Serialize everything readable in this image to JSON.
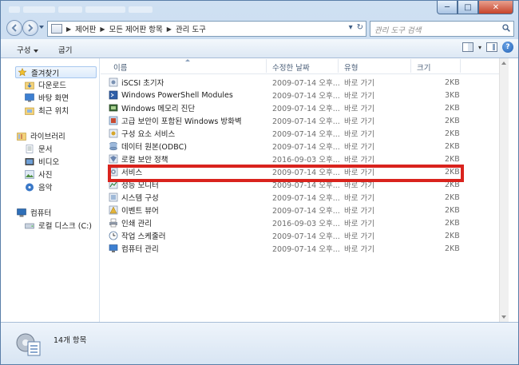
{
  "window": {
    "controls": {
      "minimize": "─",
      "maximize": "□",
      "close": "✕"
    }
  },
  "navigation": {
    "breadcrumbs": [
      "제어판",
      "모든 제어판 항목",
      "관리 도구"
    ],
    "refresh_glyph": "↻",
    "search_placeholder": "관리 도구 검색"
  },
  "toolbar": {
    "organize_label": "구성",
    "burn_label": "굽기",
    "help_glyph": "?"
  },
  "sidebar": {
    "favorites": {
      "label": "즐겨찾기",
      "items": [
        {
          "label": "다운로드"
        },
        {
          "label": "바탕 화면"
        },
        {
          "label": "최근 위치"
        }
      ]
    },
    "libraries": {
      "label": "라이브러리",
      "items": [
        {
          "label": "문서"
        },
        {
          "label": "비디오"
        },
        {
          "label": "사진"
        },
        {
          "label": "음악"
        }
      ]
    },
    "computer": {
      "label": "컴퓨터",
      "items": [
        {
          "label": "로컬 디스크 (C:)"
        }
      ]
    }
  },
  "file_list": {
    "columns": {
      "name": "이름",
      "date": "수정한 날짜",
      "type": "유형",
      "size": "크기"
    },
    "rows": [
      {
        "name": "iSCSI 초기자",
        "date": "2009-07-14 오후...",
        "type": "바로 가기",
        "size": "2KB"
      },
      {
        "name": "Windows PowerShell Modules",
        "date": "2009-07-14 오후...",
        "type": "바로 가기",
        "size": "3KB"
      },
      {
        "name": "Windows 메모리 진단",
        "date": "2009-07-14 오후...",
        "type": "바로 가기",
        "size": "2KB"
      },
      {
        "name": "고급 보안이 포함된 Windows 방화벽",
        "date": "2009-07-14 오후...",
        "type": "바로 가기",
        "size": "2KB"
      },
      {
        "name": "구성 요소 서비스",
        "date": "2009-07-14 오후...",
        "type": "바로 가기",
        "size": "2KB"
      },
      {
        "name": "데이터 원본(ODBC)",
        "date": "2009-07-14 오후...",
        "type": "바로 가기",
        "size": "2KB"
      },
      {
        "name": "로컬 보안 정책",
        "date": "2016-09-03 오후...",
        "type": "바로 가기",
        "size": "2KB"
      },
      {
        "name": "서비스",
        "date": "2009-07-14 오후...",
        "type": "바로 가기",
        "size": "2KB"
      },
      {
        "name": "성능 모니터",
        "date": "2009-07-14 오후...",
        "type": "바로 가기",
        "size": "2KB"
      },
      {
        "name": "시스템 구성",
        "date": "2009-07-14 오후...",
        "type": "바로 가기",
        "size": "2KB"
      },
      {
        "name": "이벤트 뷰어",
        "date": "2009-07-14 오후...",
        "type": "바로 가기",
        "size": "2KB"
      },
      {
        "name": "인쇄 관리",
        "date": "2016-09-03 오후...",
        "type": "바로 가기",
        "size": "2KB"
      },
      {
        "name": "작업 스케줄러",
        "date": "2009-07-14 오후...",
        "type": "바로 가기",
        "size": "2KB"
      },
      {
        "name": "컴퓨터 관리",
        "date": "2009-07-14 오후...",
        "type": "바로 가기",
        "size": "2KB"
      }
    ],
    "highlighted_row": "서비스"
  },
  "status": {
    "item_count": "14개 항목"
  },
  "colors": {
    "highlight": "#d9231d",
    "window_frame": "#b9d0ea",
    "selection": "#dcebfc"
  }
}
